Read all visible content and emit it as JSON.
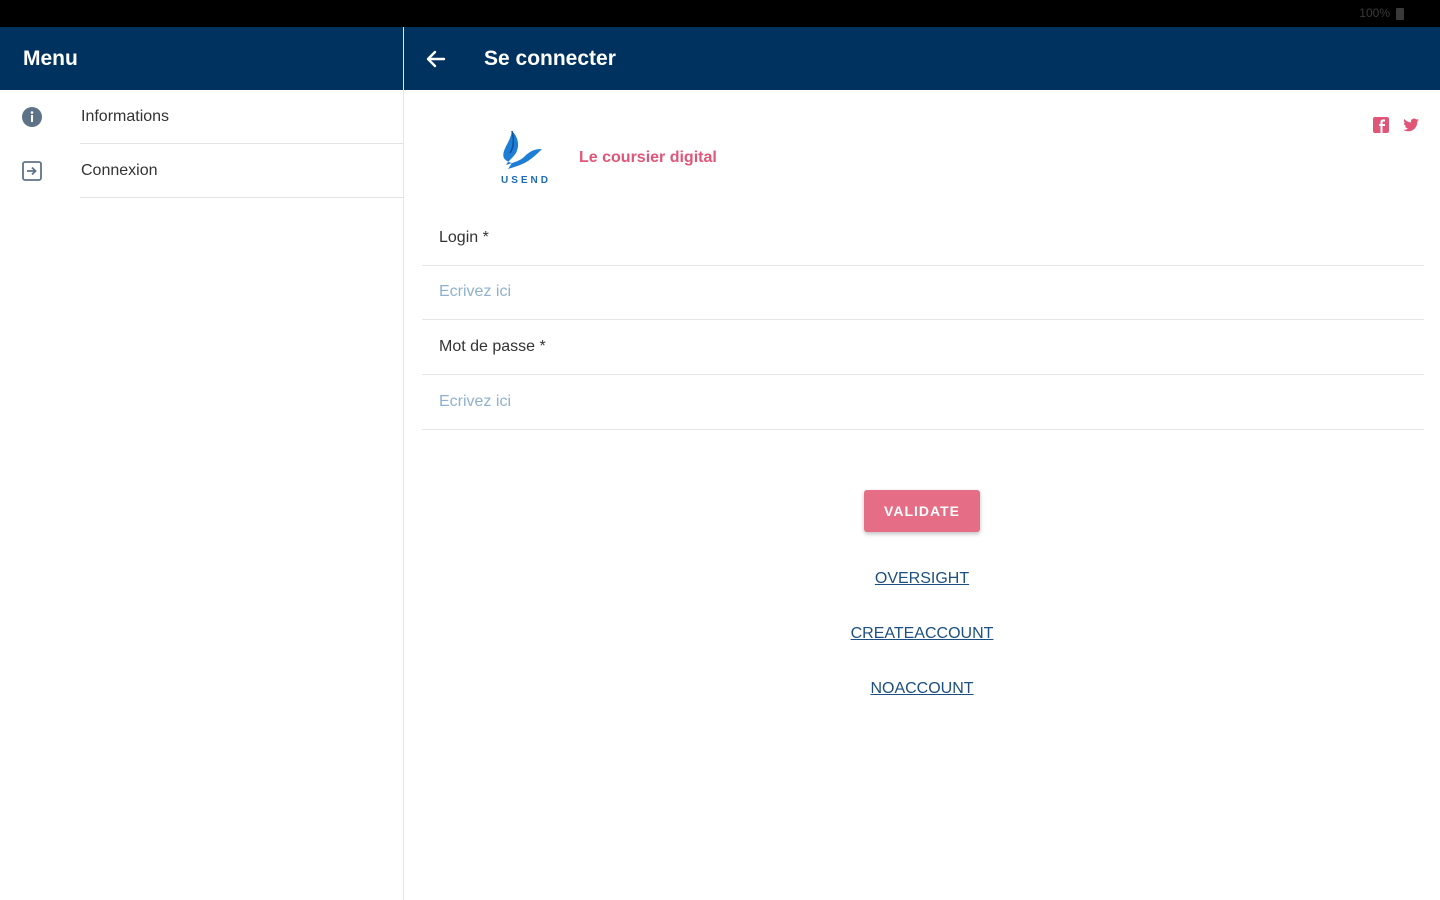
{
  "status_bar": {
    "text": "100%"
  },
  "sidebar": {
    "title": "Menu",
    "items": [
      {
        "label": "Informations",
        "icon": "info-icon"
      },
      {
        "label": "Connexion",
        "icon": "login-icon"
      }
    ]
  },
  "header": {
    "title": "Se connecter",
    "back_icon": "arrow-left-icon"
  },
  "social": {
    "icons": [
      "facebook-icon",
      "twitter-icon"
    ]
  },
  "brand": {
    "name": "USEND",
    "tagline": "Le coursier digital"
  },
  "form": {
    "login_label": "Login *",
    "login_placeholder": "Ecrivez ici",
    "password_label": "Mot de passe *",
    "password_placeholder": "Ecrivez ici"
  },
  "actions": {
    "validate_label": "VALIDATE",
    "oversight_link": "OVERSIGHT",
    "create_account_link": "CREATEACCOUNT",
    "no_account_link": "NOACCOUNT"
  },
  "colors": {
    "header_bg": "#00325f",
    "accent_pink": "#e66d86",
    "link_blue": "#1d4f82",
    "placeholder_blue": "#8fb1cf"
  }
}
